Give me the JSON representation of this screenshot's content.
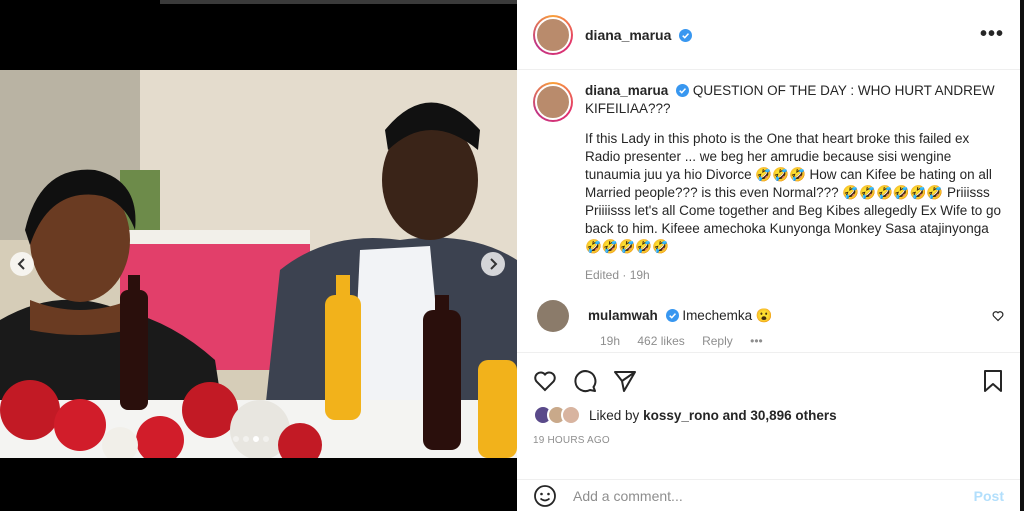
{
  "post": {
    "author": "diana_marua",
    "caption_heading": "QUESTION OF THE DAY : WHO HURT ANDREW KIFEILIAA???",
    "caption_body": "If this Lady in this photo is the One that heart broke this failed ex Radio presenter ... we beg her amrudie because sisi wengine tunaumia juu ya hio Divorce 🤣🤣🤣 How can Kifee be hating on all Married people??? is this even Normal??? 🤣🤣🤣🤣🤣🤣 Priiisss Priiiisss let's all Come together and Beg Kibes allegedly Ex Wife to go back to him. Kifeee amechoka Kunyonga Monkey Sasa atajinyonga 🤣🤣🤣🤣🤣",
    "caption_meta": "Edited · 19h",
    "more_label": "•••"
  },
  "comments": [
    {
      "user": "mulamwah",
      "text": "Imechemka 😮",
      "time": "19h",
      "likes": "462 likes",
      "reply": "Reply",
      "more": "•••"
    }
  ],
  "likes": {
    "prefix": "Liked by",
    "user": "kossy_rono",
    "suffix": "and 30,896 others"
  },
  "timeago": "19 HOURS AGO",
  "add_comment": {
    "placeholder": "Add a comment...",
    "post_label": "Post"
  },
  "icons": {
    "like": "heart-icon",
    "comment": "comment-icon",
    "share": "share-icon",
    "save": "bookmark-icon",
    "emoji": "emoji-icon",
    "prev": "chevron-left-icon",
    "next": "chevron-right-icon"
  },
  "carousel": {
    "slide_count": 4,
    "active_index": 2
  },
  "colors": {
    "verified": "#3897f0",
    "post_disabled": "#b2dffc",
    "brand_ring": "#e1306c"
  }
}
